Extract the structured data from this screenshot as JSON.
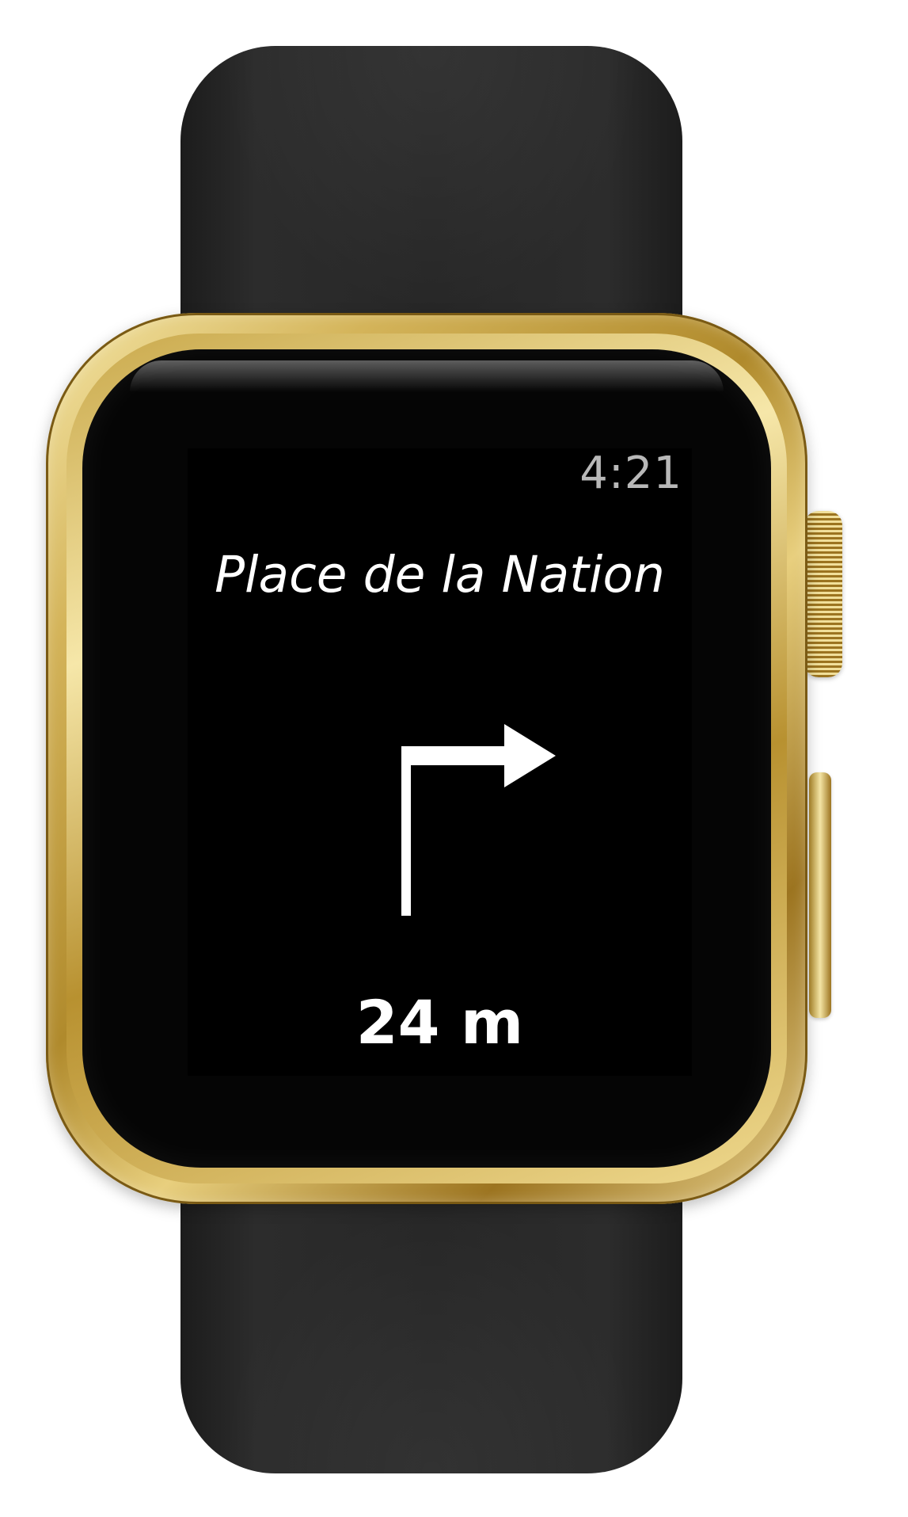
{
  "watch": {
    "time": "4:21",
    "destination": "Place de la Nation",
    "distance": "24 m",
    "maneuver_icon": "turn-right-arrow-icon"
  },
  "colors": {
    "screen_background": "#000000",
    "text_primary": "#ffffff",
    "text_time": "#b8b8b8",
    "case_gold": "#d4b45a",
    "band": "#262626"
  }
}
